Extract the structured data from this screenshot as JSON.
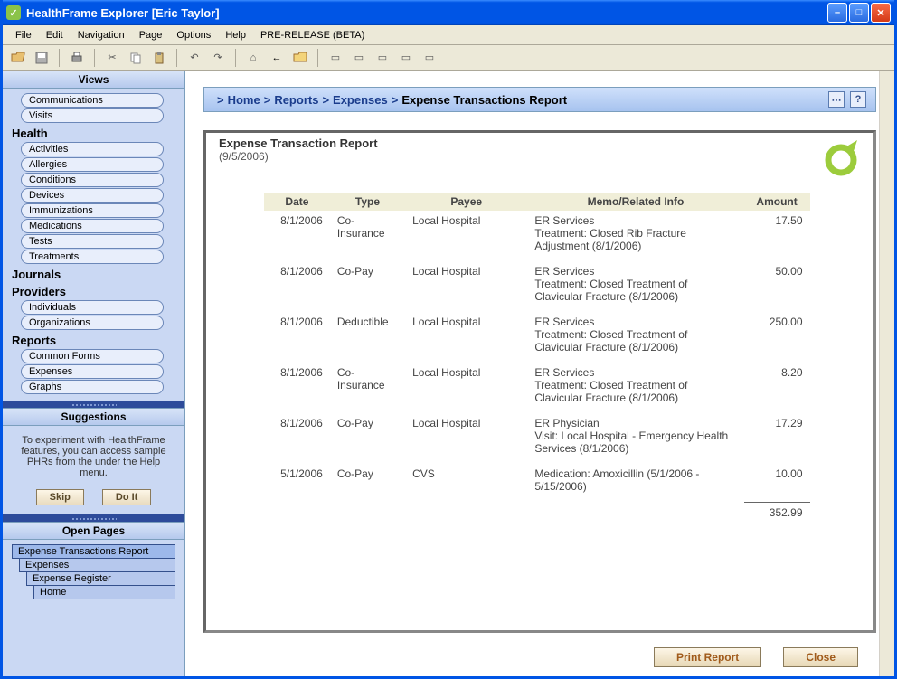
{
  "window": {
    "title": "HealthFrame Explorer [Eric Taylor]"
  },
  "menubar": [
    "File",
    "Edit",
    "Navigation",
    "Page",
    "Options",
    "Help",
    "PRE-RELEASE (BETA)"
  ],
  "sidebar": {
    "views_header": "Views",
    "top_items": [
      "Communications",
      "Visits"
    ],
    "groups": [
      {
        "title": "Health",
        "items": [
          "Activities",
          "Allergies",
          "Conditions",
          "Devices",
          "Immunizations",
          "Medications",
          "Tests",
          "Treatments"
        ]
      },
      {
        "title": "Journals",
        "items": []
      },
      {
        "title": "Providers",
        "items": [
          "Individuals",
          "Organizations"
        ]
      },
      {
        "title": "Reports",
        "items": [
          "Common Forms",
          "Expenses",
          "Graphs"
        ]
      }
    ],
    "suggestions_header": "Suggestions",
    "suggestions_text": "To experiment with HealthFrame features, you can access sample PHRs from the under the Help menu.",
    "skip_label": "Skip",
    "doit_label": "Do It",
    "open_pages_header": "Open Pages",
    "open_pages": [
      {
        "label": "Expense Transactions Report",
        "level": 0,
        "active": true
      },
      {
        "label": "Expenses",
        "level": 1,
        "active": false
      },
      {
        "label": "Expense Register",
        "level": 2,
        "active": false
      },
      {
        "label": "Home",
        "level": 3,
        "active": false
      }
    ]
  },
  "breadcrumb": {
    "items": [
      "Home",
      "Reports",
      "Expenses",
      "Expense Transactions Report"
    ]
  },
  "report": {
    "title": "Expense Transaction Report",
    "date": "(9/5/2006)",
    "columns": [
      "Date",
      "Type",
      "Payee",
      "Memo/Related Info",
      "Amount"
    ],
    "rows": [
      {
        "date": "8/1/2006",
        "type": "Co-Insurance",
        "payee": "Local Hospital",
        "memo": "ER Services\nTreatment: Closed Rib Fracture Adjustment (8/1/2006)",
        "amount": "17.50"
      },
      {
        "date": "8/1/2006",
        "type": "Co-Pay",
        "payee": "Local Hospital",
        "memo": "ER Services\nTreatment: Closed Treatment of Clavicular Fracture (8/1/2006)",
        "amount": "50.00"
      },
      {
        "date": "8/1/2006",
        "type": "Deductible",
        "payee": "Local Hospital",
        "memo": "ER Services\nTreatment: Closed Treatment of Clavicular Fracture (8/1/2006)",
        "amount": "250.00"
      },
      {
        "date": "8/1/2006",
        "type": "Co-Insurance",
        "payee": "Local Hospital",
        "memo": "ER Services\nTreatment: Closed Treatment of Clavicular Fracture (8/1/2006)",
        "amount": "8.20"
      },
      {
        "date": "8/1/2006",
        "type": "Co-Pay",
        "payee": "Local Hospital",
        "memo": "ER Physician\nVisit: Local Hospital - Emergency Health Services (8/1/2006)",
        "amount": "17.29"
      },
      {
        "date": "5/1/2006",
        "type": "Co-Pay",
        "payee": "CVS",
        "memo": "Medication: Amoxicillin (5/1/2006 - 5/15/2006)",
        "amount": "10.00"
      }
    ],
    "total": "352.99"
  },
  "buttons": {
    "print": "Print Report",
    "close": "Close"
  }
}
